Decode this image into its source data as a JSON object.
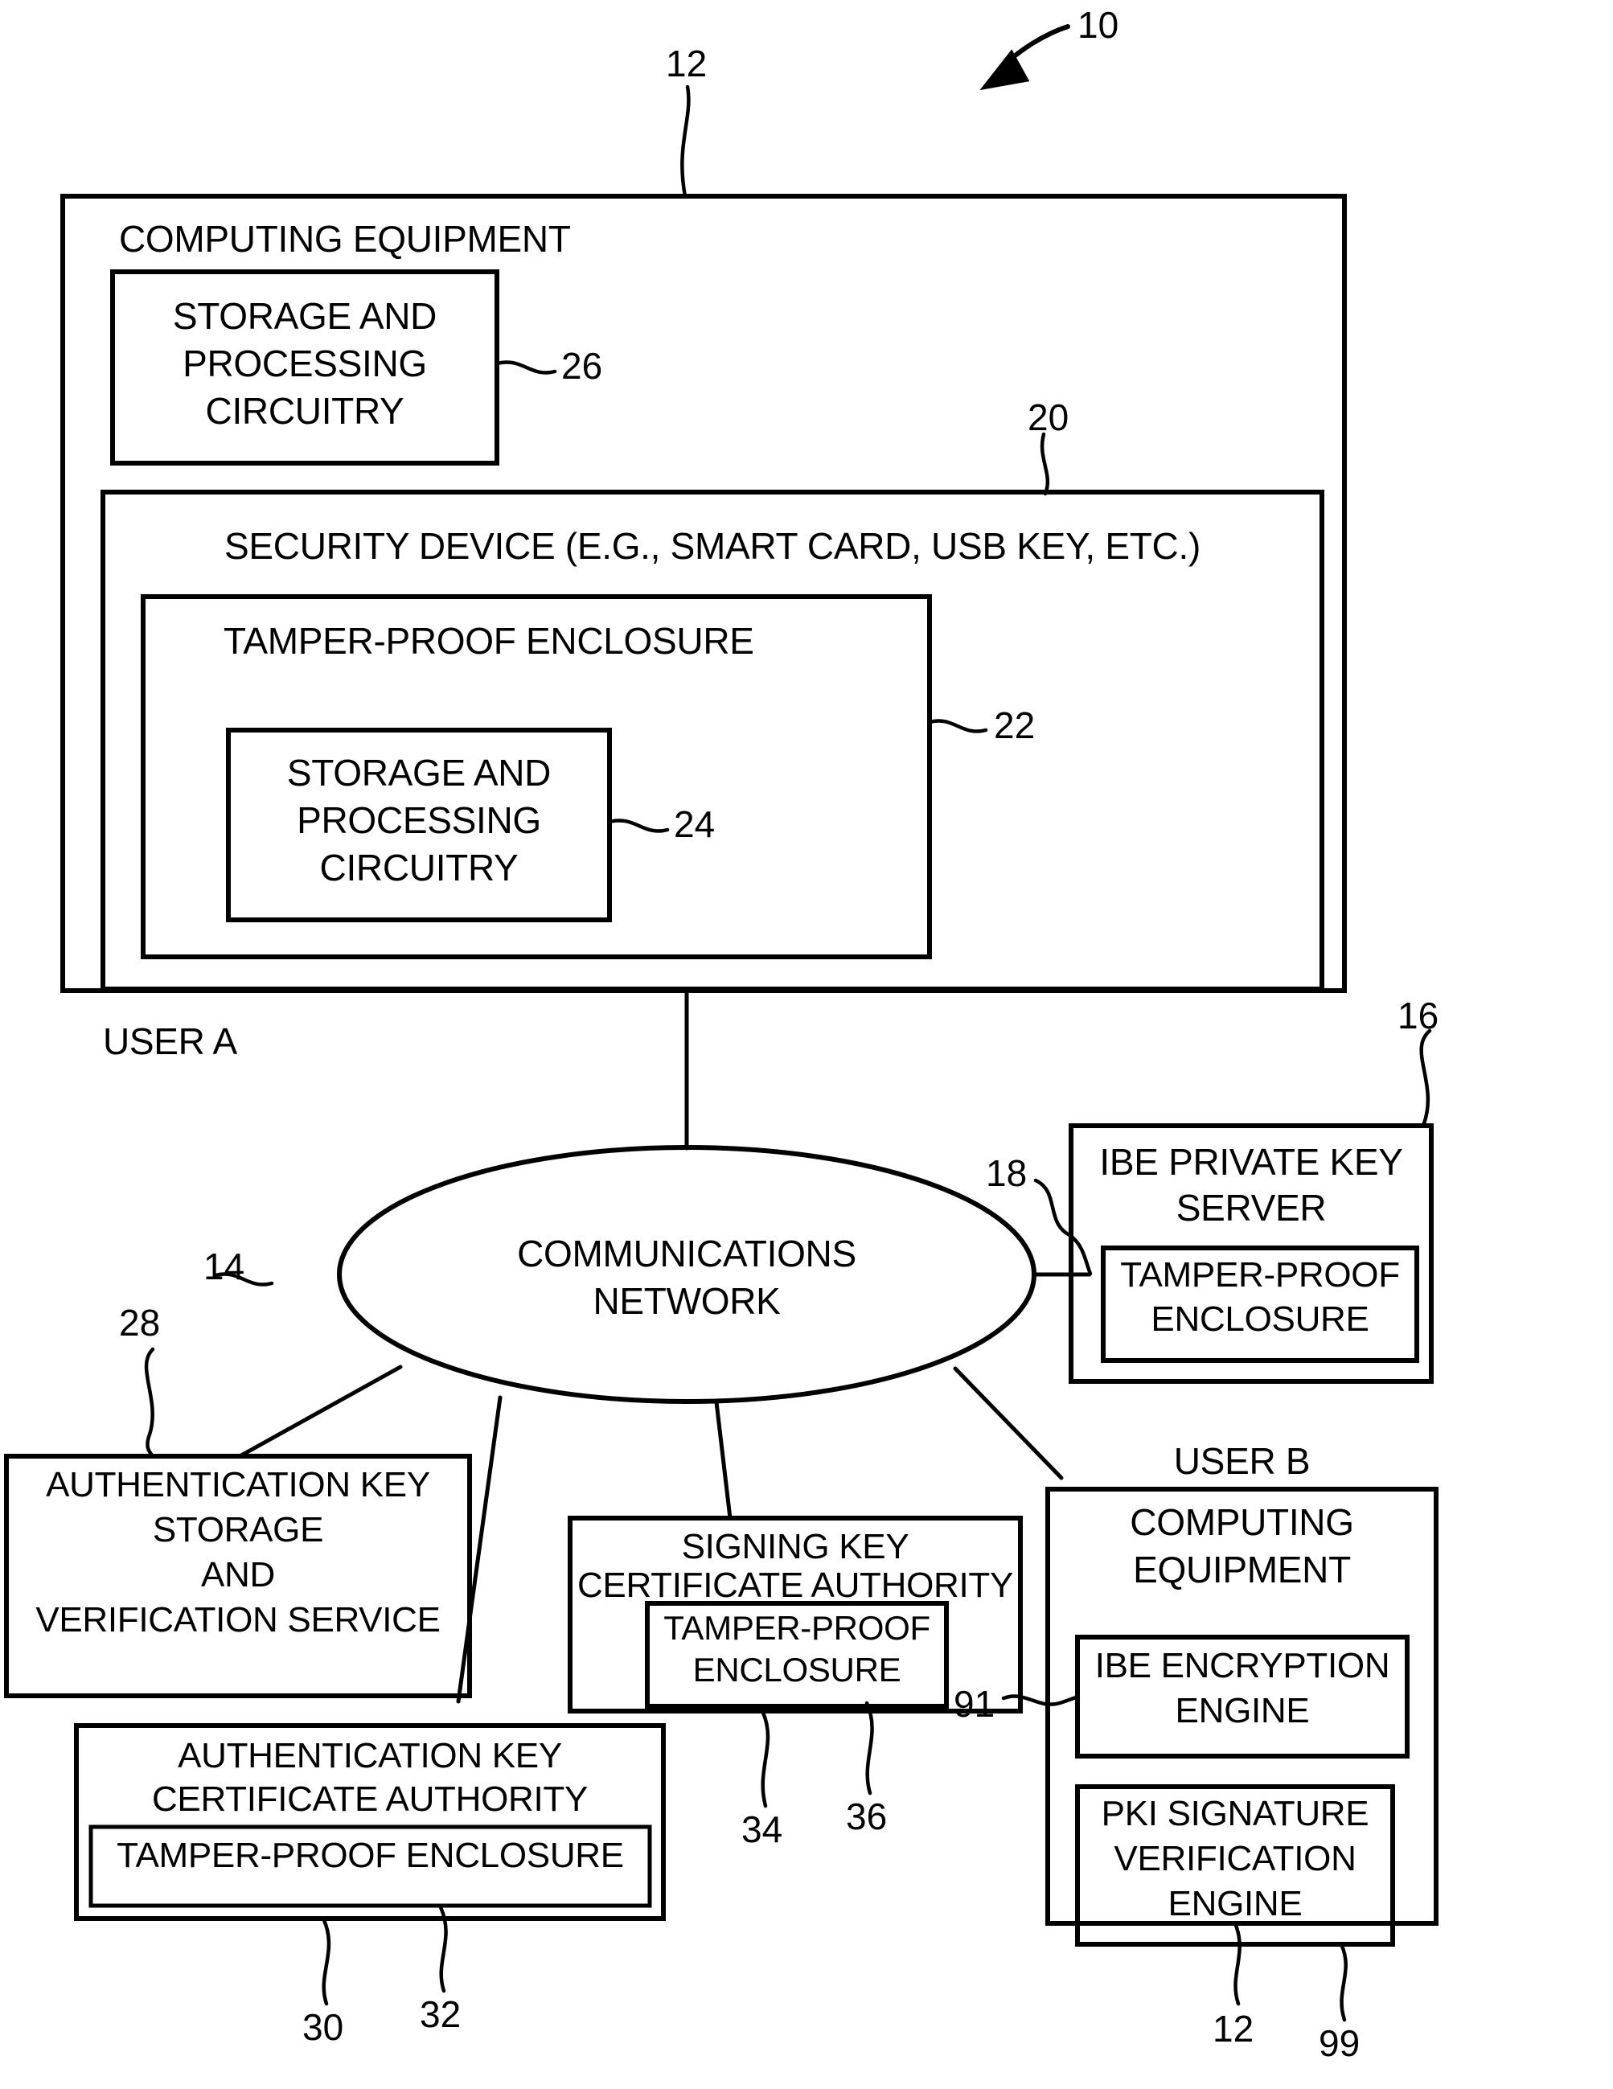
{
  "figure": {
    "reference_numeral": "10",
    "user_a_label": "USER A",
    "user_b_label": "USER B"
  },
  "user_a": {
    "computing_equipment": {
      "title": "COMPUTING EQUIPMENT",
      "ref": "12",
      "storage_processing": {
        "line1": "STORAGE AND",
        "line2": "PROCESSING",
        "line3": "CIRCUITRY",
        "ref": "26"
      },
      "security_device": {
        "title": "SECURITY DEVICE (E.G., SMART CARD, USB KEY, ETC.)",
        "ref": "20",
        "tamper_proof_enclosure": {
          "title": "TAMPER-PROOF ENCLOSURE",
          "ref": "22",
          "storage_processing": {
            "line1": "STORAGE AND",
            "line2": "PROCESSING",
            "line3": "CIRCUITRY",
            "ref": "24"
          }
        }
      }
    }
  },
  "network": {
    "line1": "COMMUNICATIONS",
    "line2": "NETWORK",
    "ref": "14"
  },
  "ibe_private_key_server": {
    "line1": "IBE PRIVATE KEY",
    "line2": "SERVER",
    "ref": "16",
    "connector_ref": "18",
    "tamper_proof_enclosure": {
      "line1": "TAMPER-PROOF",
      "line2": "ENCLOSURE"
    }
  },
  "auth_key_storage_service": {
    "line1": "AUTHENTICATION KEY",
    "line2": "STORAGE",
    "line3": "AND",
    "line4": "VERIFICATION SERVICE",
    "ref": "28"
  },
  "signing_key_ca": {
    "line1": "SIGNING KEY",
    "line2": "CERTIFICATE AUTHORITY",
    "ref": "34",
    "tamper_proof_enclosure": {
      "line1": "TAMPER-PROOF",
      "line2": "ENCLOSURE",
      "ref": "36"
    }
  },
  "auth_key_ca": {
    "line1": "AUTHENTICATION KEY",
    "line2": "CERTIFICATE AUTHORITY",
    "ref": "30",
    "tamper_proof_enclosure": {
      "text": "TAMPER-PROOF ENCLOSURE",
      "ref": "32"
    }
  },
  "user_b": {
    "computing_equipment": {
      "line1": "COMPUTING",
      "line2": "EQUIPMENT",
      "ref": "12"
    },
    "ibe_encryption_engine": {
      "line1": "IBE ENCRYPTION",
      "line2": "ENGINE",
      "ref": "91"
    },
    "pki_signature_verification_engine": {
      "line1": "PKI SIGNATURE",
      "line2": "VERIFICATION",
      "line3": "ENGINE",
      "ref": "99"
    }
  }
}
